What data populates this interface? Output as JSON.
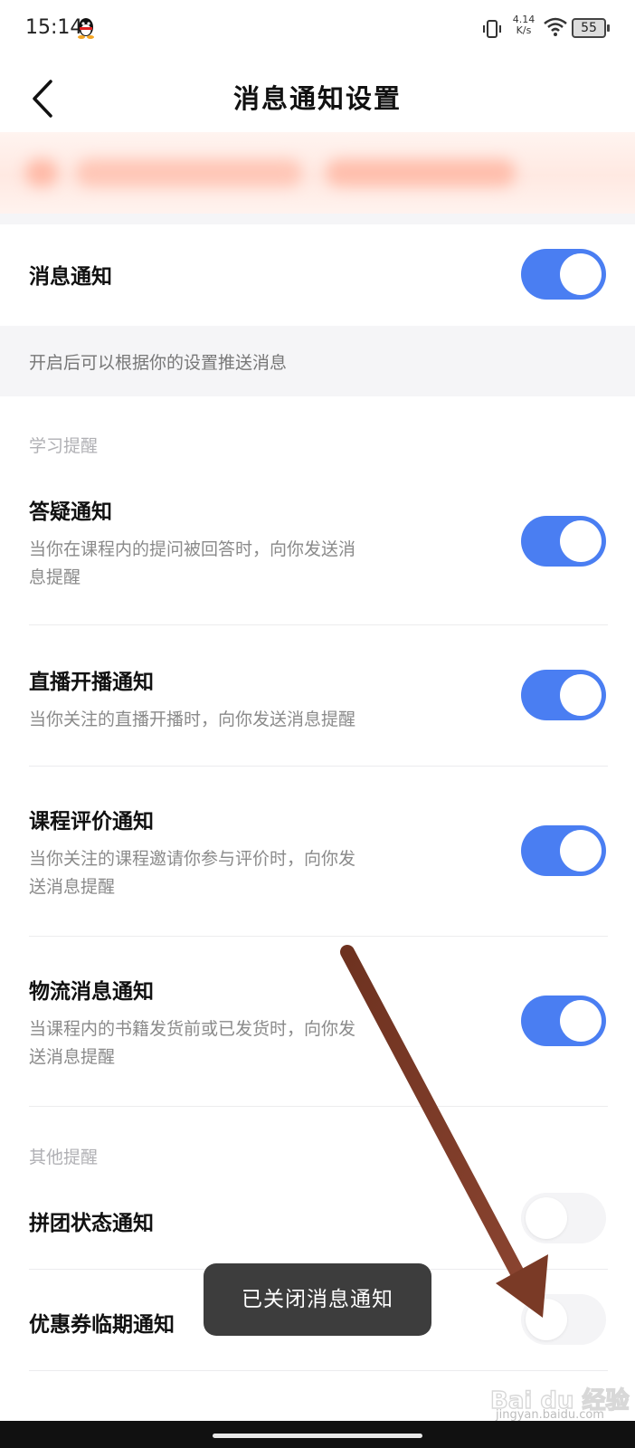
{
  "status_bar": {
    "time": "15:14",
    "net_speed_value": "4.14",
    "net_speed_unit": "K/s",
    "battery": "55"
  },
  "header": {
    "title": "消息通知设置"
  },
  "main_toggle": {
    "label": "消息通知",
    "enabled": true
  },
  "hint": "开启后可以根据你的设置推送消息",
  "groups": [
    {
      "label": "学习提醒",
      "items": [
        {
          "title": "答疑通知",
          "desc_line1": "当你在课程内的提问被回答时，向你发送消",
          "desc_line2": "息提醒",
          "enabled": true
        },
        {
          "title": "直播开播通知",
          "desc_line1": "当你关注的直播开播时，向你发送消息提醒",
          "desc_line2": "",
          "enabled": true
        },
        {
          "title": "课程评价通知",
          "desc_line1": "当你关注的课程邀请你参与评价时，向你发",
          "desc_line2": "送消息提醒",
          "enabled": true
        },
        {
          "title": "物流消息通知",
          "desc_line1": "当课程内的书籍发货前或已发货时，向你发",
          "desc_line2": "送消息提醒",
          "enabled": true
        }
      ]
    },
    {
      "label": "其他提醒",
      "items": [
        {
          "title": "拼团状态通知",
          "enabled": false
        },
        {
          "title": "优惠券临期通知",
          "enabled": false
        }
      ]
    }
  ],
  "toast": "已关闭消息通知",
  "watermark": {
    "brand": "Bai du 经验",
    "url": "jingyan.baidu.com"
  },
  "colors": {
    "toggle_on": "#4a7ef2",
    "toggle_off": "#f4f4f6",
    "annotation_arrow": "#7a3a26"
  }
}
